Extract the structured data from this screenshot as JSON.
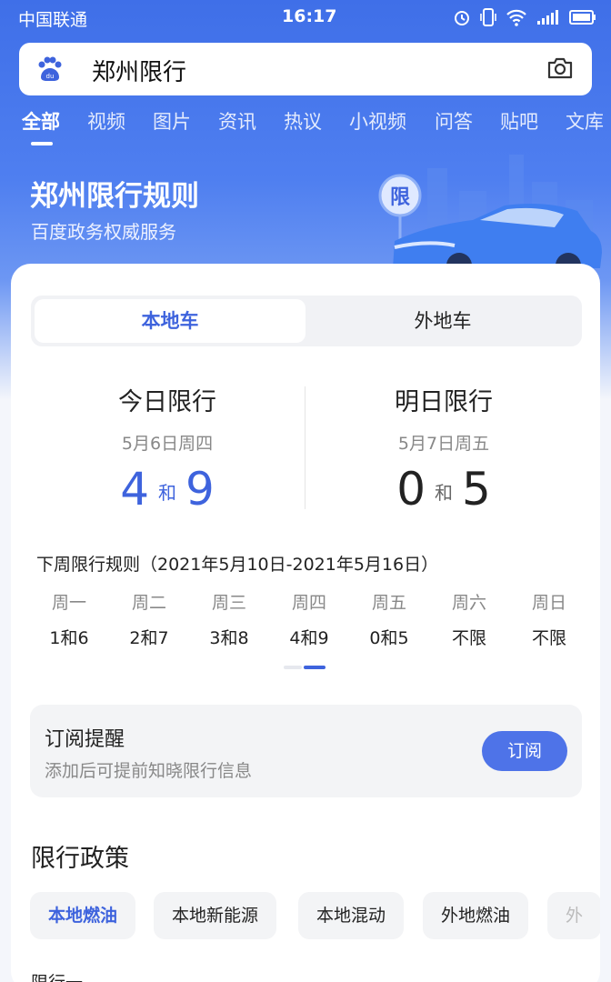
{
  "status_bar": {
    "carrier": "中国联通",
    "time": "16:17",
    "icons": [
      "alarm-icon",
      "vibrate-icon",
      "wifi-icon",
      "signal-icon",
      "battery-icon"
    ]
  },
  "search": {
    "query": "郑州限行",
    "logo": "baidu-paw-icon",
    "camera": "camera-icon"
  },
  "tabs": [
    {
      "label": "全部",
      "active": true
    },
    {
      "label": "视频"
    },
    {
      "label": "图片"
    },
    {
      "label": "资讯"
    },
    {
      "label": "热议"
    },
    {
      "label": "小视频"
    },
    {
      "label": "问答"
    },
    {
      "label": "贴吧"
    },
    {
      "label": "文库"
    }
  ],
  "hero": {
    "title": "郑州限行规则",
    "subtitle": "百度政务权威服务",
    "badge": "限"
  },
  "segment": {
    "local": "本地车",
    "nonlocal": "外地车"
  },
  "today": {
    "label": "今日限行",
    "date": "5月6日周四",
    "num1": "4",
    "and": "和",
    "num2": "9"
  },
  "tomorrow": {
    "label": "明日限行",
    "date": "5月7日周五",
    "num1": "0",
    "and": "和",
    "num2": "5"
  },
  "next_week": {
    "title": "下周限行规则（2021年5月10日-2021年5月16日）",
    "days": [
      {
        "day": "周一",
        "value": "1和6"
      },
      {
        "day": "周二",
        "value": "2和7"
      },
      {
        "day": "周三",
        "value": "3和8"
      },
      {
        "day": "周四",
        "value": "4和9"
      },
      {
        "day": "周五",
        "value": "0和5"
      },
      {
        "day": "周六",
        "value": "不限"
      },
      {
        "day": "周日",
        "value": "不限"
      }
    ]
  },
  "subscribe": {
    "title": "订阅提醒",
    "desc": "添加后可提前知晓限行信息",
    "button": "订阅"
  },
  "policy": {
    "title": "限行政策",
    "chips": [
      "本地燃油",
      "本地新能源",
      "本地混动",
      "外地燃油",
      "外"
    ],
    "active_chip": "本地燃油",
    "next_label": "限行一"
  },
  "colors": {
    "brand_blue": "#3e63dd",
    "header_blue": "#4a78ec"
  }
}
